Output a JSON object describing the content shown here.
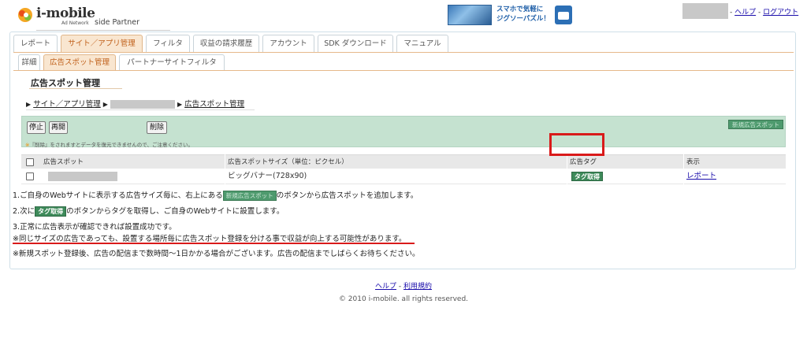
{
  "header": {
    "logo_text": "i-mobile",
    "logo_sub": "Ad Network",
    "logo_partner": "side Partner",
    "banner_text_line1": "スマホで気軽に",
    "banner_text_line2": "ジグソーパズル！",
    "links": {
      "sep1": "-",
      "help": "ヘルプ",
      "sep2": "-",
      "logout": "ログアウト"
    }
  },
  "tabs": [
    "レポート",
    "サイト／アプリ管理",
    "フィルタ",
    "収益の請求履歴",
    "アカウント",
    "SDK ダウンロード",
    "マニュアル"
  ],
  "active_tab": "サイト／アプリ管理",
  "subtabs": [
    "詳細",
    "広告スポット管理",
    "パートナーサイトフィルタ"
  ],
  "active_subtab": "広告スポット管理",
  "page_title": "広告スポット管理",
  "breadcrumb": {
    "item1": "サイト／アプリ管理",
    "item3": "広告スポット管理"
  },
  "toolbar": {
    "stop": "停止",
    "resume": "再開",
    "delete": "削除",
    "note_star": "※",
    "note": "『削除』をされますとデータを復元できませんので、ご注意ください。",
    "new_spot": "新規広告スポット"
  },
  "table": {
    "headers": [
      "広告スポット",
      "広告スポットサイズ（単位：ピクセル）",
      "広告タグ",
      "表示"
    ],
    "rows": [
      {
        "size": "ビッグバナー(728x90)",
        "tag_button": "タグ取得",
        "display_link": "レポート"
      }
    ]
  },
  "notes": {
    "line1_a": "1.ご自身のWebサイトに表示する広告サイズ毎に、右上にある",
    "line1_btn": "新規広告スポット",
    "line1_b": "のボタンから広告スポットを追加します。",
    "line2_a": "2.次に",
    "line2_btn": "タグ取得",
    "line2_b": "のボタンからタグを取得し、ご自身のWebサイトに設置します。",
    "line3": "3.正常に広告表示が確認できれば設置成功です。",
    "line4": "※同じサイズの広告であっても、設置する場所毎に広告スポット登録を分ける事で収益が向上する可能性があります。",
    "line5": "※新規スポット登録後、広告の配信まで数時間〜1日かかる場合がございます。広告の配信までしばらくお待ちください。"
  },
  "footer": {
    "help": "ヘルプ",
    "sep": "-",
    "terms": "利用規約",
    "copyright": "© 2010 i-mobile. all rights reserved."
  },
  "colors": {
    "accent": "#c0601a",
    "toolbar_bg": "#c5e2d0",
    "tag_button": "#3e8a5a",
    "highlight": "#d91a1a"
  }
}
